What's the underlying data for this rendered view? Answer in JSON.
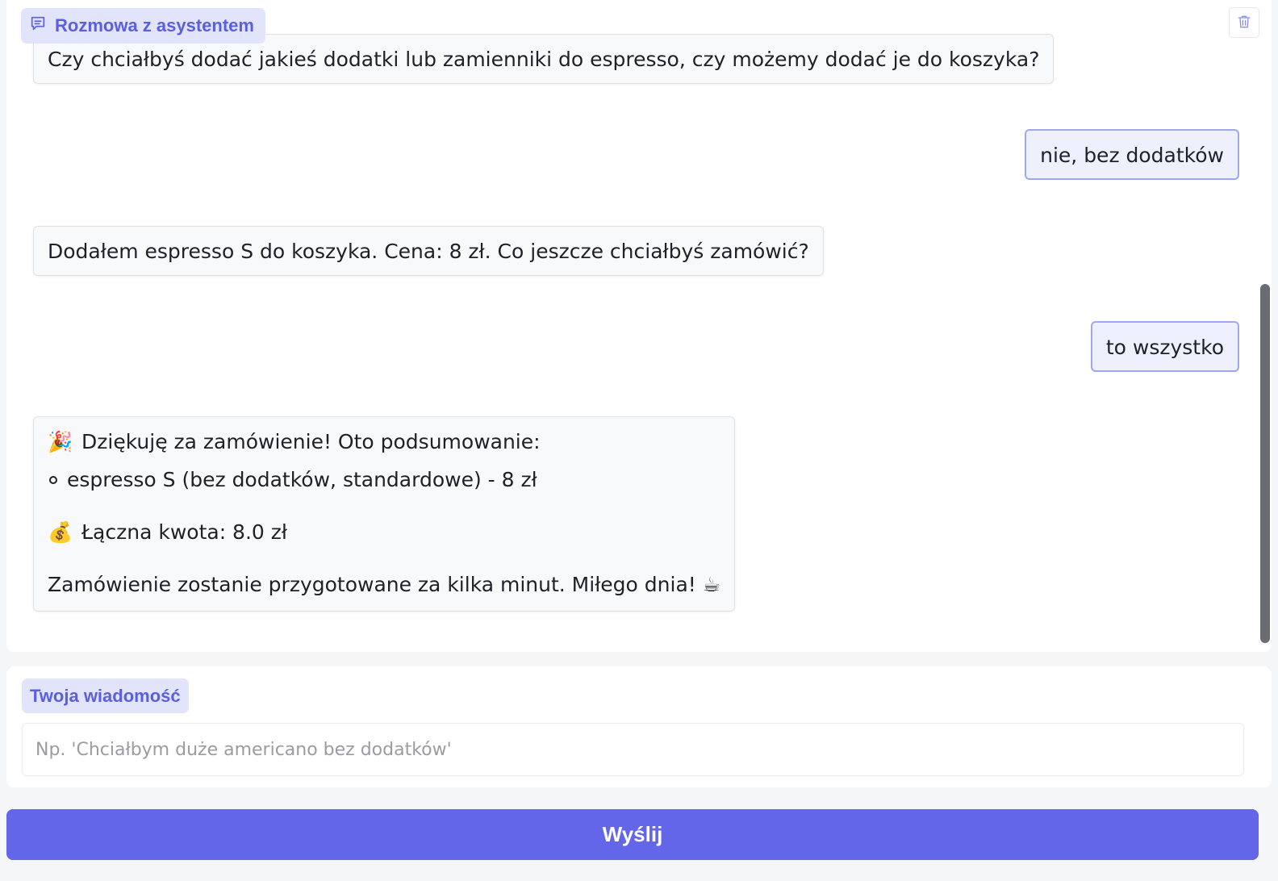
{
  "chat": {
    "label": "Rozmowa z asystentem",
    "clear_icon": "trash-icon",
    "messages": [
      {
        "role": "bot",
        "text": "Czy chciałbyś dodać jakieś dodatki lub zamienniki do espresso, czy możemy dodać je do koszyka?"
      },
      {
        "role": "user",
        "text": "nie, bez dodatków"
      },
      {
        "role": "bot",
        "text": "Dodałem espresso S do koszyka. Cena: 8 zł. Co jeszcze chciałbyś zamówić?"
      },
      {
        "role": "user",
        "text": "to wszystko"
      }
    ],
    "summary": {
      "heading_emoji": "🎉",
      "heading": "Dziękuję za zamówienie! Oto podsumowanie:",
      "items": [
        "espresso S (bez dodatków, standardowe) - 8 zł"
      ],
      "total_emoji": "💰",
      "total": "Łączna kwota: 8.0 zł",
      "closing": "Zamówienie zostanie przygotowane za kilka minut. Miłego dnia!",
      "closing_emoji": "☕"
    }
  },
  "composer": {
    "label": "Twoja wiadomość",
    "value": "",
    "placeholder": "Np. 'Chciałbym duże americano bez dodatków'",
    "send_label": "Wyślij"
  },
  "colors": {
    "accent": "#6366e8",
    "label_bg": "#e2e4fc",
    "label_text": "#5a5fe0",
    "user_bubble_border": "#9fa6f2"
  }
}
